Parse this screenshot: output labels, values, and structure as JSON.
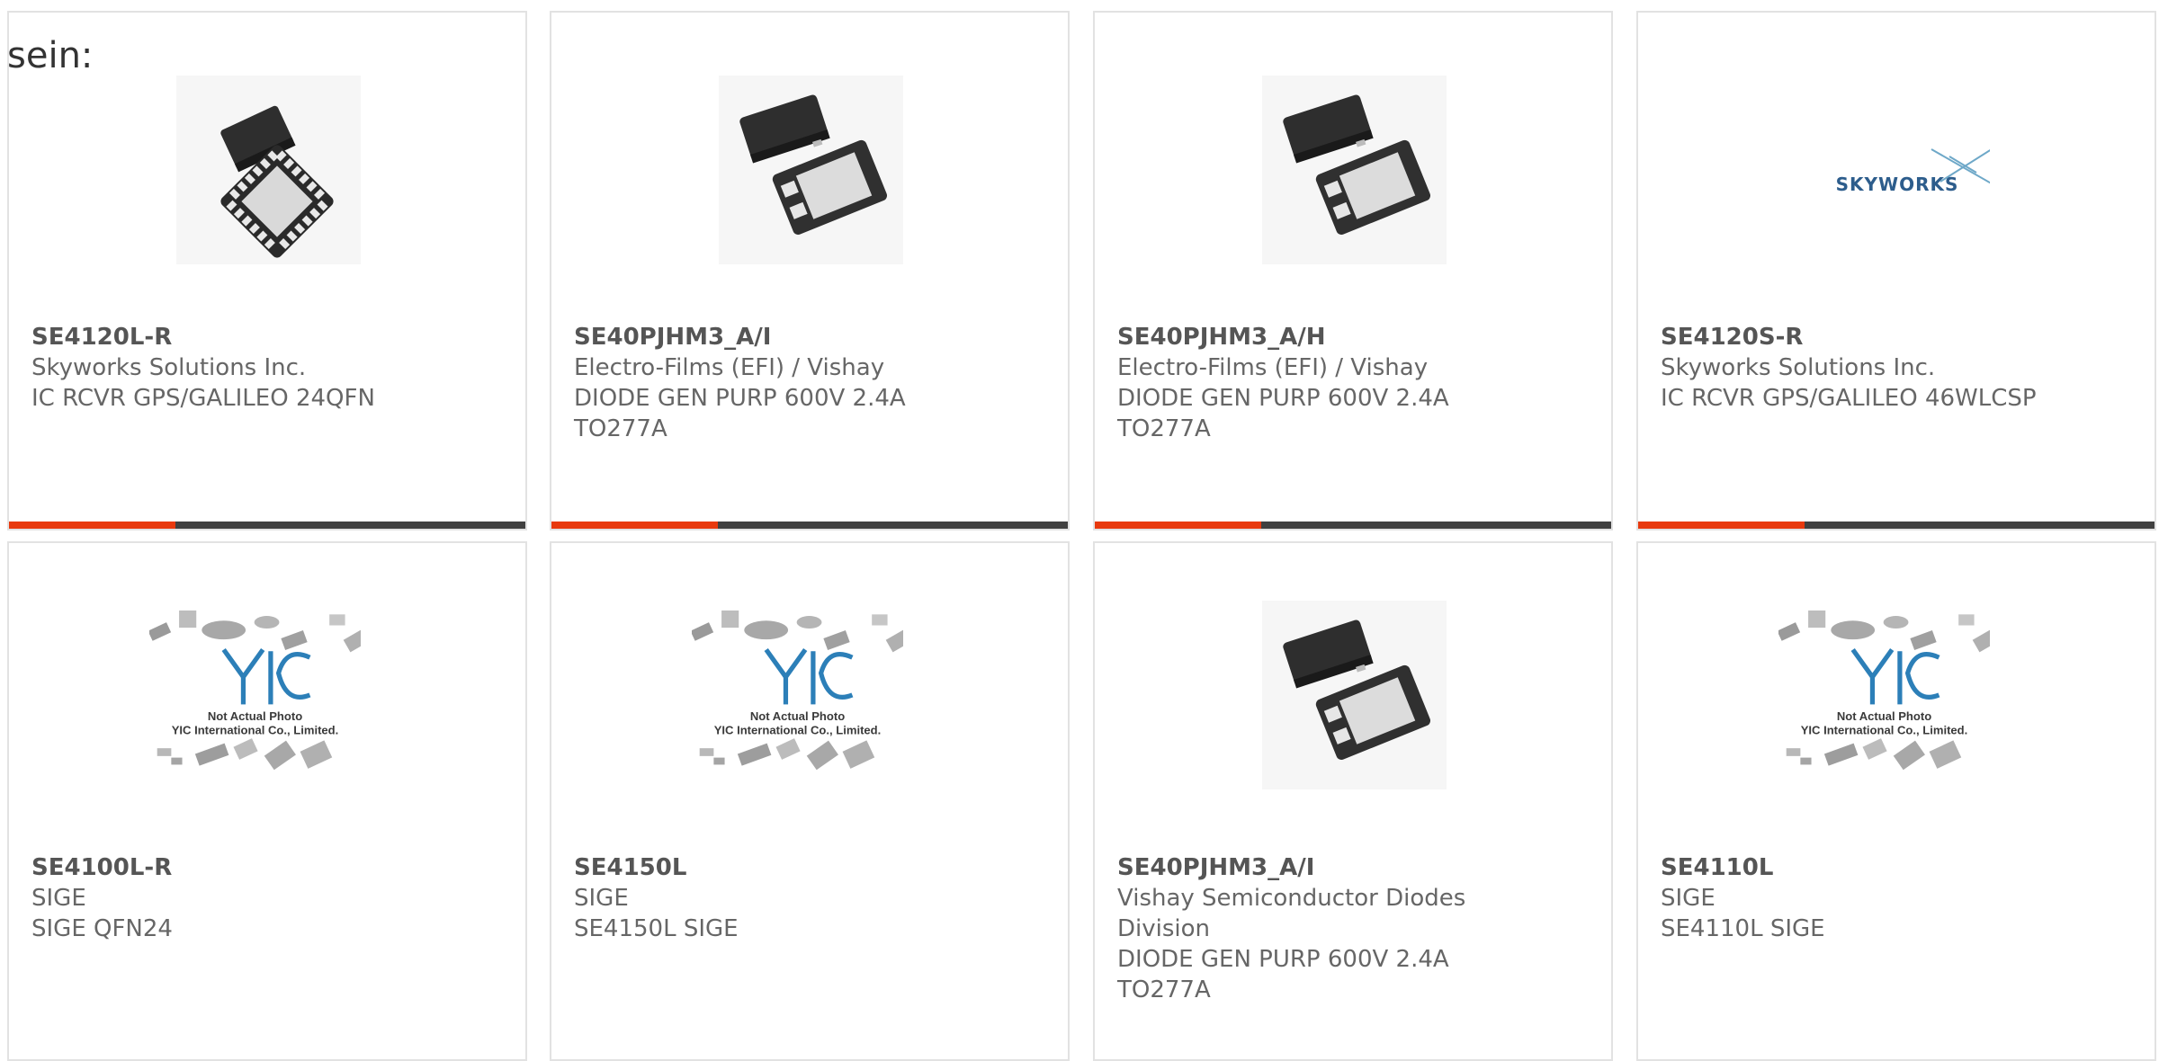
{
  "intro_text": "sein:",
  "colors": {
    "accent": "#e8390e",
    "bar": "#404040",
    "border": "#e2e2e2"
  },
  "products": [
    {
      "part": "SE4120L-R",
      "lines": [
        "Skyworks Solutions Inc.",
        "IC RCVR GPS/GALILEO 24QFN"
      ],
      "image": "qfn-chip-icon"
    },
    {
      "part": "SE40PJHM3_A/I",
      "lines": [
        "Electro-Films (EFI) / Vishay",
        "DIODE GEN PURP 600V 2.4A",
        "TO277A"
      ],
      "image": "smd-diode-icon"
    },
    {
      "part": "SE40PJHM3_A/H",
      "lines": [
        "Electro-Films (EFI) / Vishay",
        "DIODE GEN PURP 600V 2.4A",
        "TO277A"
      ],
      "image": "smd-diode-icon"
    },
    {
      "part": "SE4120S-R",
      "lines": [
        "Skyworks Solutions Inc.",
        "IC RCVR GPS/GALILEO 46WLCSP"
      ],
      "image": "skyworks-logo",
      "logo_text": "SKYWORKS"
    },
    {
      "part": "SE4100L-R",
      "lines": [
        "SIGE",
        "SIGE QFN24"
      ],
      "image": "yic-placeholder",
      "ph_line1": "Not Actual Photo",
      "ph_line2": "YIC International Co., Limited."
    },
    {
      "part": "SE4150L",
      "lines": [
        "SIGE",
        "SE4150L SIGE"
      ],
      "image": "yic-placeholder",
      "ph_line1": "Not Actual Photo",
      "ph_line2": "YIC International Co., Limited."
    },
    {
      "part": "SE40PJHM3_A/I",
      "lines": [
        "Vishay Semiconductor Diodes",
        "Division",
        "DIODE GEN PURP 600V 2.4A",
        "TO277A"
      ],
      "image": "smd-diode-icon"
    },
    {
      "part": "SE4110L",
      "lines": [
        "SIGE",
        "SE4110L SIGE"
      ],
      "image": "yic-placeholder",
      "ph_line1": "Not Actual Photo",
      "ph_line2": "YIC International Co., Limited."
    }
  ]
}
